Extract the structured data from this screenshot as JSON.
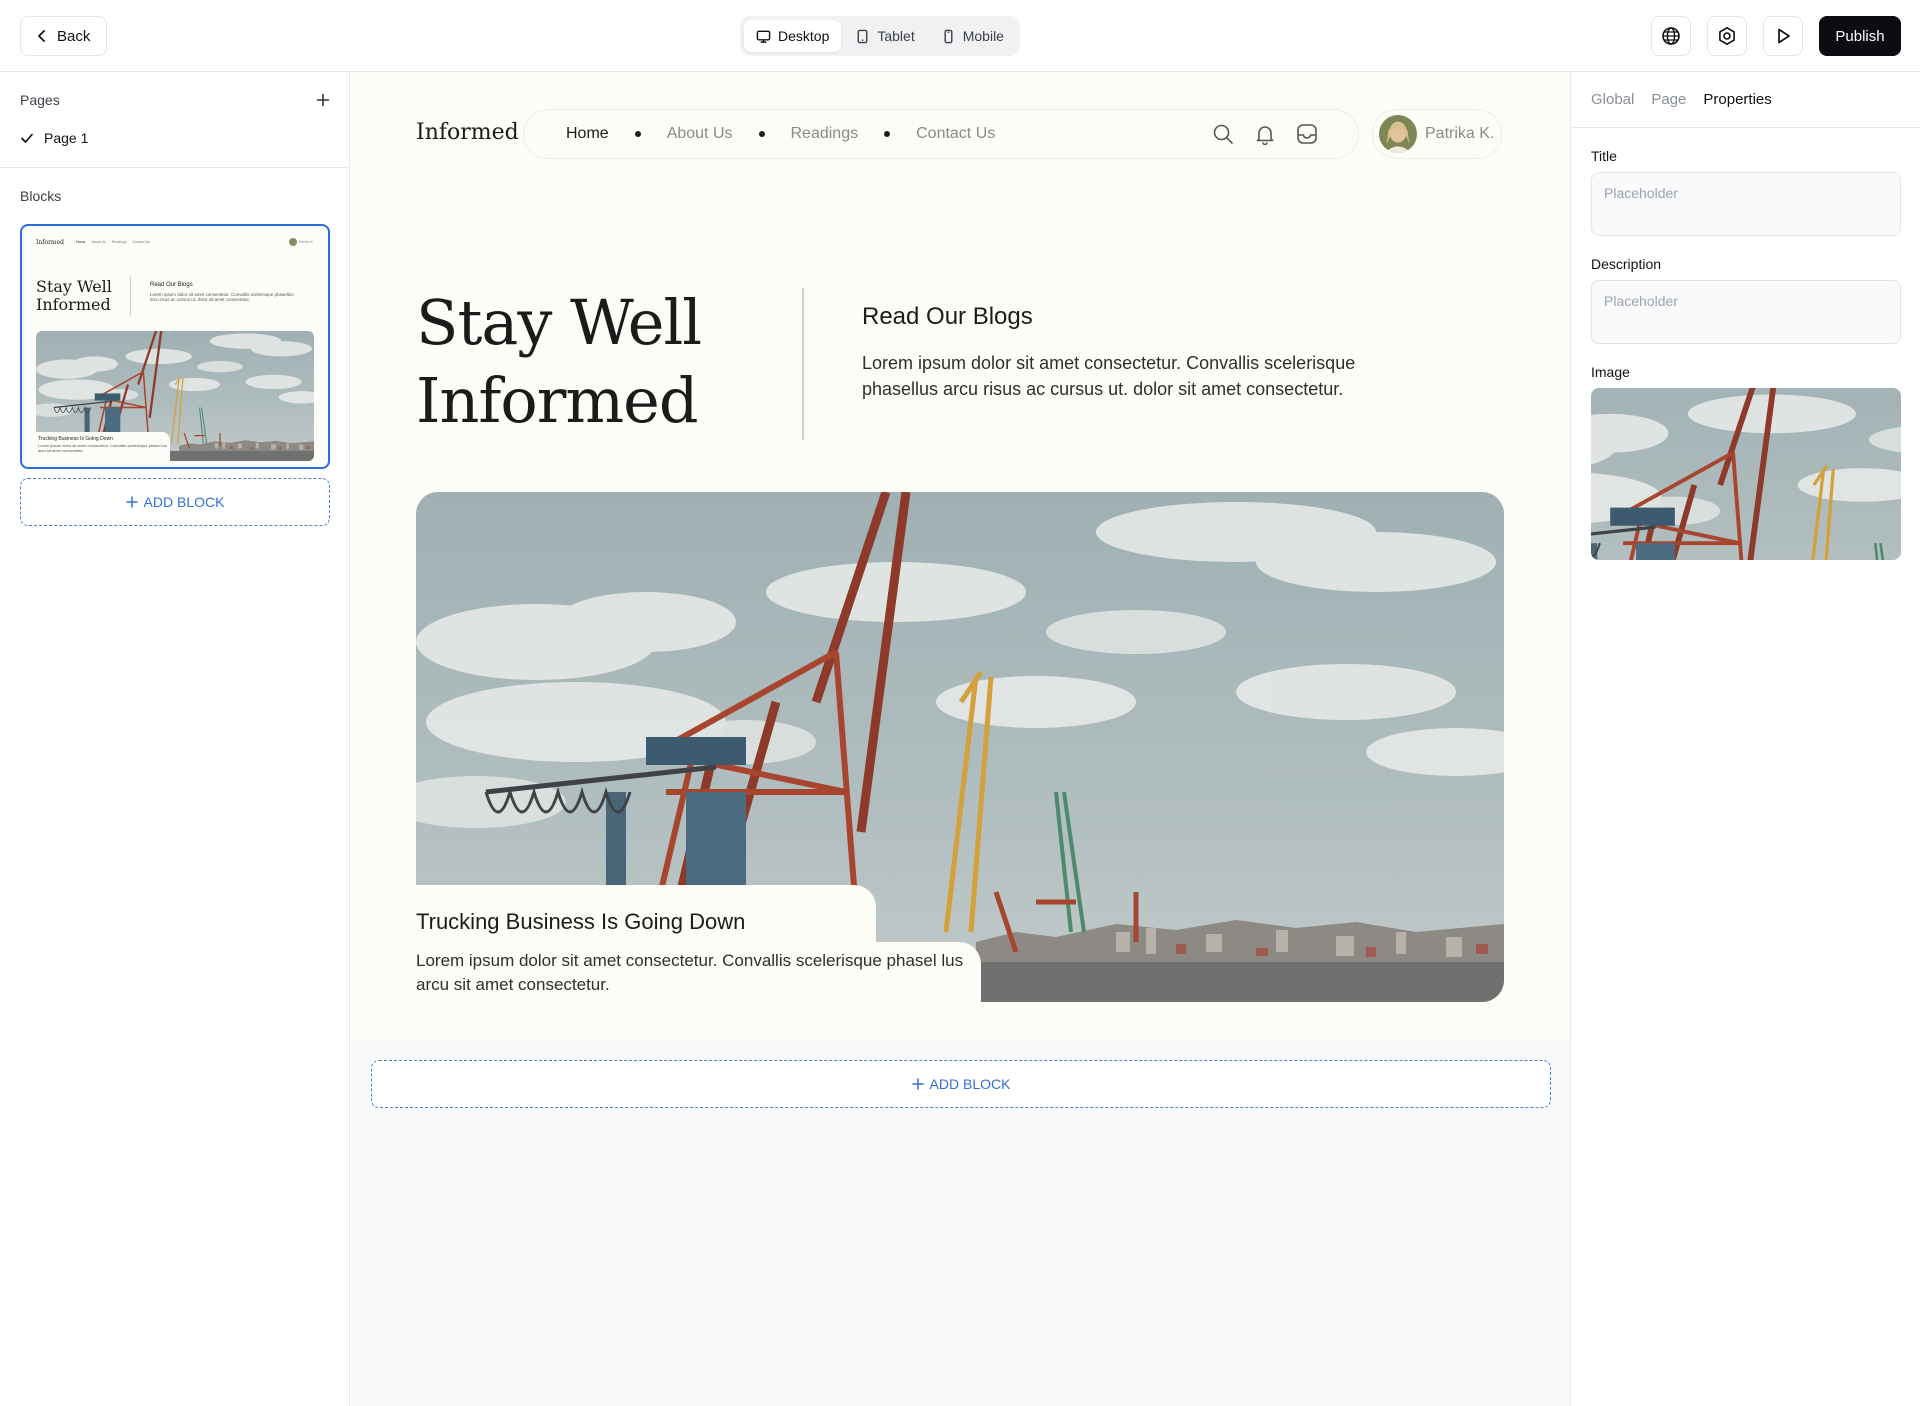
{
  "topbar": {
    "back_label": "Back",
    "devices": [
      {
        "label": "Desktop",
        "icon": "monitor-icon"
      },
      {
        "label": "Tablet",
        "icon": "tablet-icon"
      },
      {
        "label": "Mobile",
        "icon": "mobile-icon"
      }
    ],
    "active_device": "Desktop",
    "publish_label": "Publish"
  },
  "left": {
    "pages_title": "Pages",
    "pages": [
      "Page 1"
    ],
    "blocks_title": "Blocks",
    "add_block": "ADD BLOCK"
  },
  "site": {
    "logo": "Informed",
    "nav": [
      "Home",
      "About Us",
      "Readings",
      "Contact Us"
    ],
    "active_nav": "Home",
    "user_name": "Patrika K.",
    "hero_line1": "Stay Well",
    "hero_line2": "Informed",
    "blog_title": "Read Our Blogs",
    "blog_text": "Lorem ipsum dolor sit amet consectetur. Convallis scelerisque phasellus arcu risus ac cursus ut. dolor sit amet consectetur.",
    "card_title": "Trucking Business Is Going Down",
    "card_text": "Lorem ipsum dolor sit amet consectetur. Convallis scelerisque phasel lus arcu sit amet consectetur."
  },
  "canvas": {
    "add_block": "ADD BLOCK"
  },
  "right": {
    "tabs": [
      "Global",
      "Page",
      "Properties"
    ],
    "active_tab": "Properties",
    "title_label": "Title",
    "title_placeholder": "Placeholder",
    "description_label": "Description",
    "description_placeholder": "Placeholder",
    "image_label": "Image"
  },
  "colors": {
    "accent": "#2d6cdf",
    "publish_bg": "#0b0d12",
    "page_bg": "#fdfdf8"
  }
}
